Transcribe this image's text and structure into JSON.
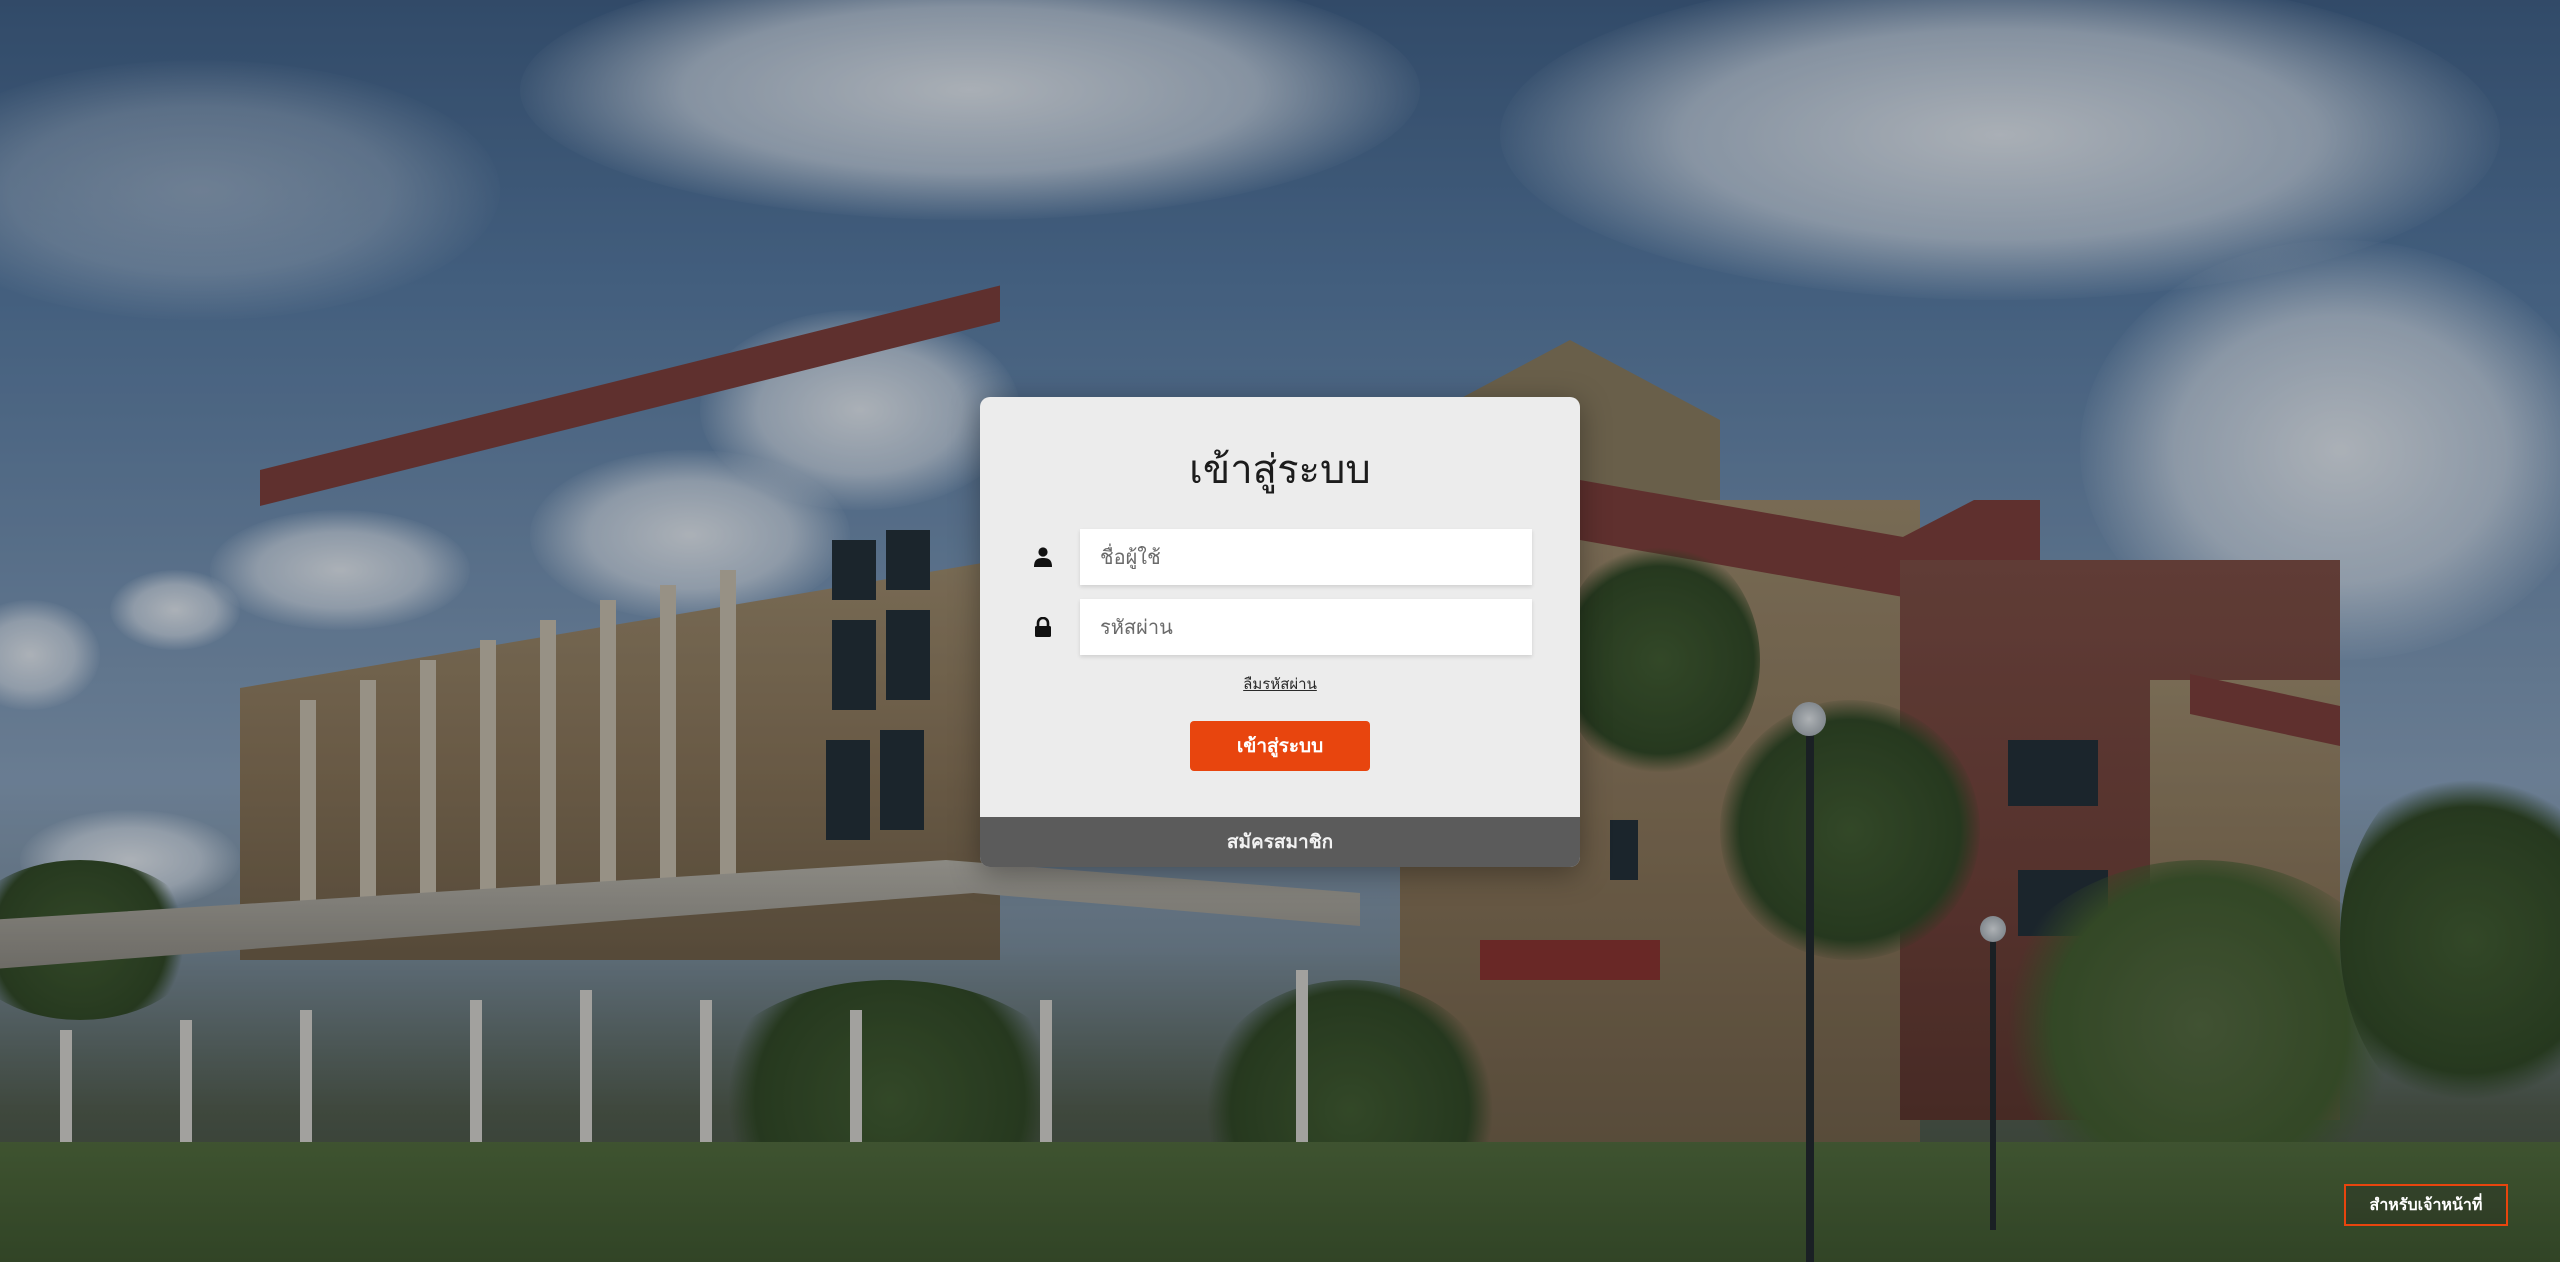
{
  "login": {
    "title": "เข้าสู่ระบบ",
    "username_placeholder": "ชื่อผู้ใช้",
    "password_placeholder": "รหัสผ่าน",
    "forgot_password": "ลืมรหัสผ่าน",
    "submit_label": "เข้าสู่ระบบ",
    "register_label": "สมัครสมาชิก"
  },
  "staff": {
    "button_label": "สำหรับเจ้าหน้าที่"
  },
  "icons": {
    "username": "user-icon",
    "password": "lock-icon"
  },
  "colors": {
    "accent": "#e8450e",
    "card_bg": "#ececec",
    "register_bar": "#5b5b5b"
  }
}
